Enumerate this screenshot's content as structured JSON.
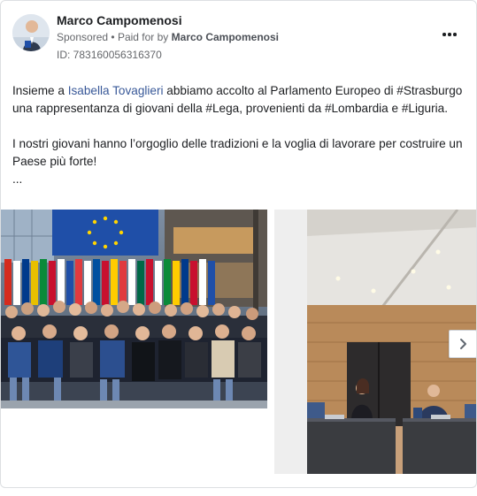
{
  "post": {
    "author": "Marco Campomenosi",
    "sponsored_label": "Sponsored",
    "paid_for_prefix": "Paid for by",
    "paid_for_name": "Marco Campomenosi",
    "id_label": "ID: 783160056316370",
    "text": {
      "p1_before": "Insieme a ",
      "p1_link": "Isabella Tovaglieri",
      "p1_after": " abbiamo accolto al Parlamento Europeo di #Strasburgo una rappresentanza di giovani della #Lega, provenienti da #Lombardia e #Liguria.",
      "p2": "I nostri giovani hanno l’orgoglio delle tradizioni e la voglia di lavorare per costruire un Paese più forte!",
      "ellipsis": "..."
    }
  },
  "icons": {
    "more": "more-options-icon",
    "next": "chevron-right-icon"
  },
  "colors": {
    "link": "#385898",
    "text": "#1c1e21",
    "meta": "#65676b",
    "eu_blue": "#1f4fa8"
  }
}
